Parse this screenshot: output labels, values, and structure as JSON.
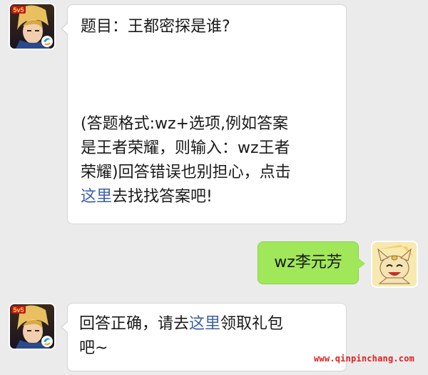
{
  "messages": [
    {
      "sender": "game-account",
      "question": "题目：王都密探是谁?",
      "format_line1": "(答题格式:wz+选项,例如答案",
      "format_line2": "是王者荣耀，则输入：wz王者",
      "format_line3": "荣耀)回答错误也别担心，点击",
      "link_text": "这里",
      "format_line4_rest": "去找找答案吧!"
    },
    {
      "sender": "user",
      "text": "wz李元芳"
    },
    {
      "sender": "game-account",
      "reply_prefix": "回答正确，请去",
      "link_text": "这里",
      "reply_suffix": "领取礼包",
      "reply_line2": "吧~"
    }
  ],
  "avatars": {
    "game_badge_text": "5v5"
  },
  "watermark": "www.qinpinchang.com",
  "colors": {
    "background": "#ebebeb",
    "incoming_bubble": "#ffffff",
    "outgoing_bubble": "#a0e75a",
    "link": "#3a5fa8",
    "watermark": "#e02020"
  }
}
